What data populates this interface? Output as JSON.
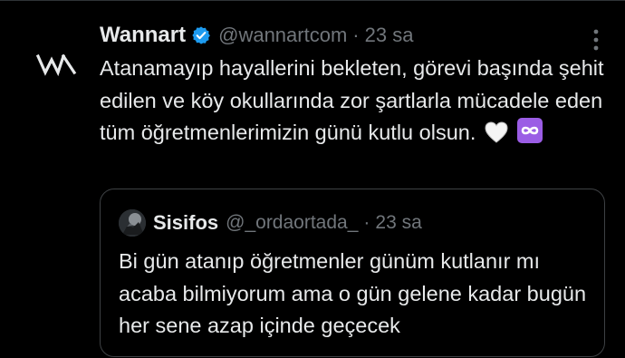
{
  "tweet": {
    "author_name": "Wannart",
    "author_handle": "@wannartcom",
    "separator": "·",
    "time": "23 sa",
    "text": "Atanamayıp hayallerini bekleten, görevi başında şehit edilen ve köy okullarında zor şartlarla mücadele eden tüm öğretmenlerimizin günü kutlu olsun.",
    "logo_text": "WA",
    "emojis": [
      "white-heart-icon",
      "infinity-icon"
    ]
  },
  "quote": {
    "author_name": "Sisifos",
    "author_handle": "@_ordaortada_",
    "separator": "·",
    "time": "23 sa",
    "text": "Bi gün atanıp öğretmenler günüm kutlanır mı acaba bilmiyorum ama o gün gelene kadar bugün her sene azap içinde geçecek"
  },
  "colors": {
    "background": "#000000",
    "text": "#e7e9ea",
    "secondary_text": "#71767b",
    "verified_blue": "#1d9bf0",
    "border": "#2f3336",
    "infinity_purple": "#9b5de5"
  }
}
